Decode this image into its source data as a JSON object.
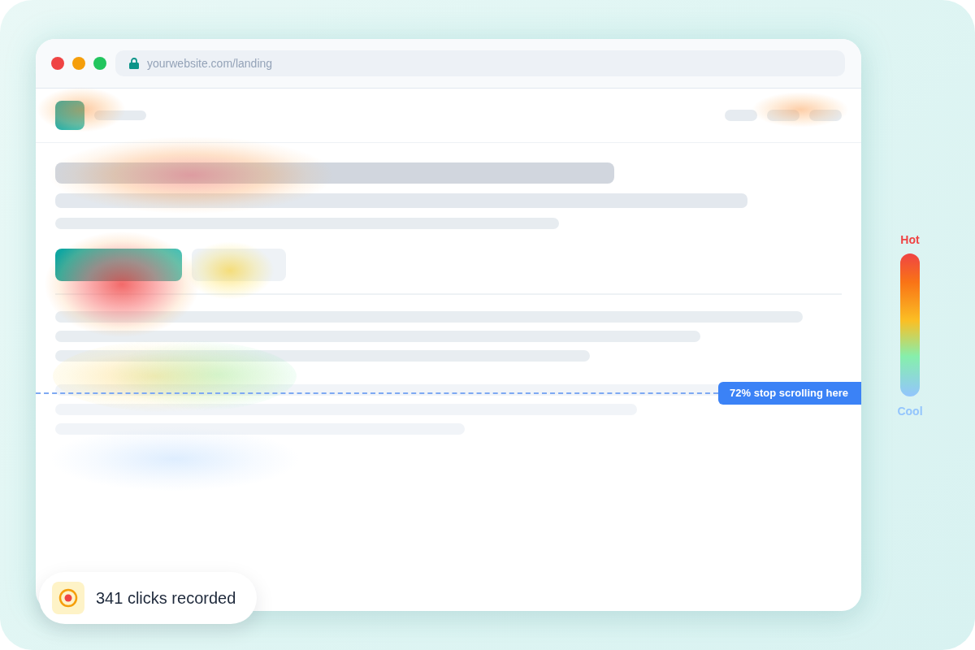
{
  "browser": {
    "url": "yourwebsite.com/landing"
  },
  "scroll_marker": {
    "label": "72% stop scrolling here"
  },
  "legend": {
    "hot_label": "Hot",
    "cool_label": "Cool"
  },
  "clicks_badge": {
    "label": "341 clicks recorded"
  }
}
